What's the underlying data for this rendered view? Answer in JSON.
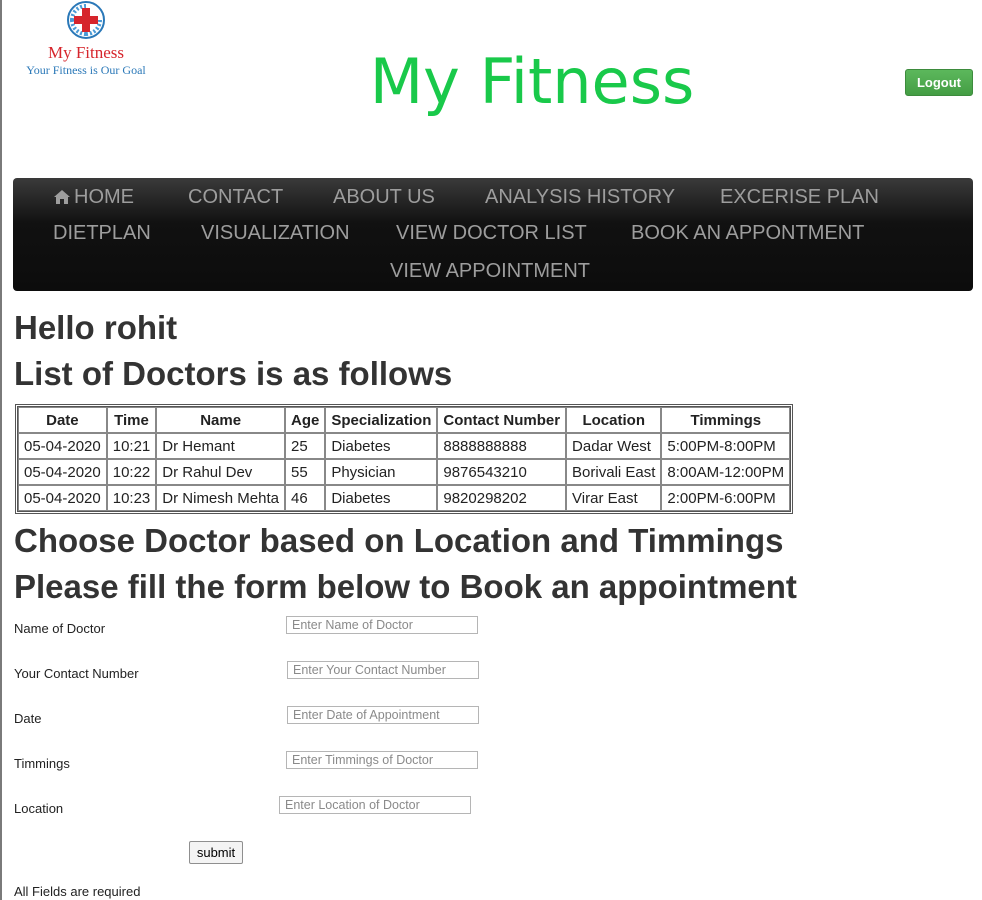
{
  "header": {
    "logo_name": "My Fitness",
    "logo_tagline": "Your Fitness is Our Goal",
    "title": "My Fitness",
    "logout_label": "Logout"
  },
  "nav": {
    "home": "HOME",
    "contact": "CONTACT",
    "about": "ABOUT US",
    "analysis_history": "ANALYSIS HISTORY",
    "exercise_plan": "EXCERISE PLAN",
    "dietplan": "DIETPLAN",
    "visualization": "VISUALIZATION",
    "view_doctor_list": "VIEW DOCTOR LIST",
    "book_appointment": "BOOK AN APPONTMENT",
    "view_appointment": "VIEW APPOINTMENT"
  },
  "greeting": "Hello rohit",
  "list_heading": "List of Doctors is as follows",
  "table": {
    "headers": [
      "Date",
      "Time",
      "Name",
      "Age",
      "Specialization",
      "Contact Number",
      "Location",
      "Timmings"
    ],
    "rows": [
      [
        "05-04-2020",
        "10:21",
        "Dr Hemant",
        "25",
        "Diabetes",
        "8888888888",
        "Dadar West",
        "5:00PM-8:00PM"
      ],
      [
        "05-04-2020",
        "10:22",
        "Dr Rahul Dev",
        "55",
        "Physician",
        "9876543210",
        "Borivali East",
        "8:00AM-12:00PM"
      ],
      [
        "05-04-2020",
        "10:23",
        "Dr Nimesh Mehta",
        "46",
        "Diabetes",
        "9820298202",
        "Virar East",
        "2:00PM-6:00PM"
      ]
    ]
  },
  "choose_heading": "Choose Doctor based on Location and Timmings",
  "form_heading": "Please fill the form below to Book an appointment",
  "form": {
    "doctor_name": {
      "label": "Name of Doctor",
      "placeholder": "Enter Name of Doctor",
      "value": ""
    },
    "contact": {
      "label": "Your Contact Number",
      "placeholder": "Enter Your Contact Number",
      "value": ""
    },
    "date": {
      "label": "Date",
      "placeholder": "Enter Date of Appointment",
      "value": ""
    },
    "timmings": {
      "label": "Timmings",
      "placeholder": "Enter Timmings of Doctor",
      "value": ""
    },
    "location": {
      "label": "Location",
      "placeholder": "Enter Location of Doctor",
      "value": ""
    },
    "submit_label": "submit",
    "required_note": "All Fields are required"
  },
  "colors": {
    "title_green": "#19c94a",
    "logout_green": "#5cb85c",
    "navbar_bg": "#111111",
    "nav_text": "#9d9d9d",
    "logo_red": "#d6252c",
    "logo_blue": "#2a78b8"
  },
  "icons": {
    "home": "home-icon",
    "logo": "medical-cross-logo-icon"
  }
}
